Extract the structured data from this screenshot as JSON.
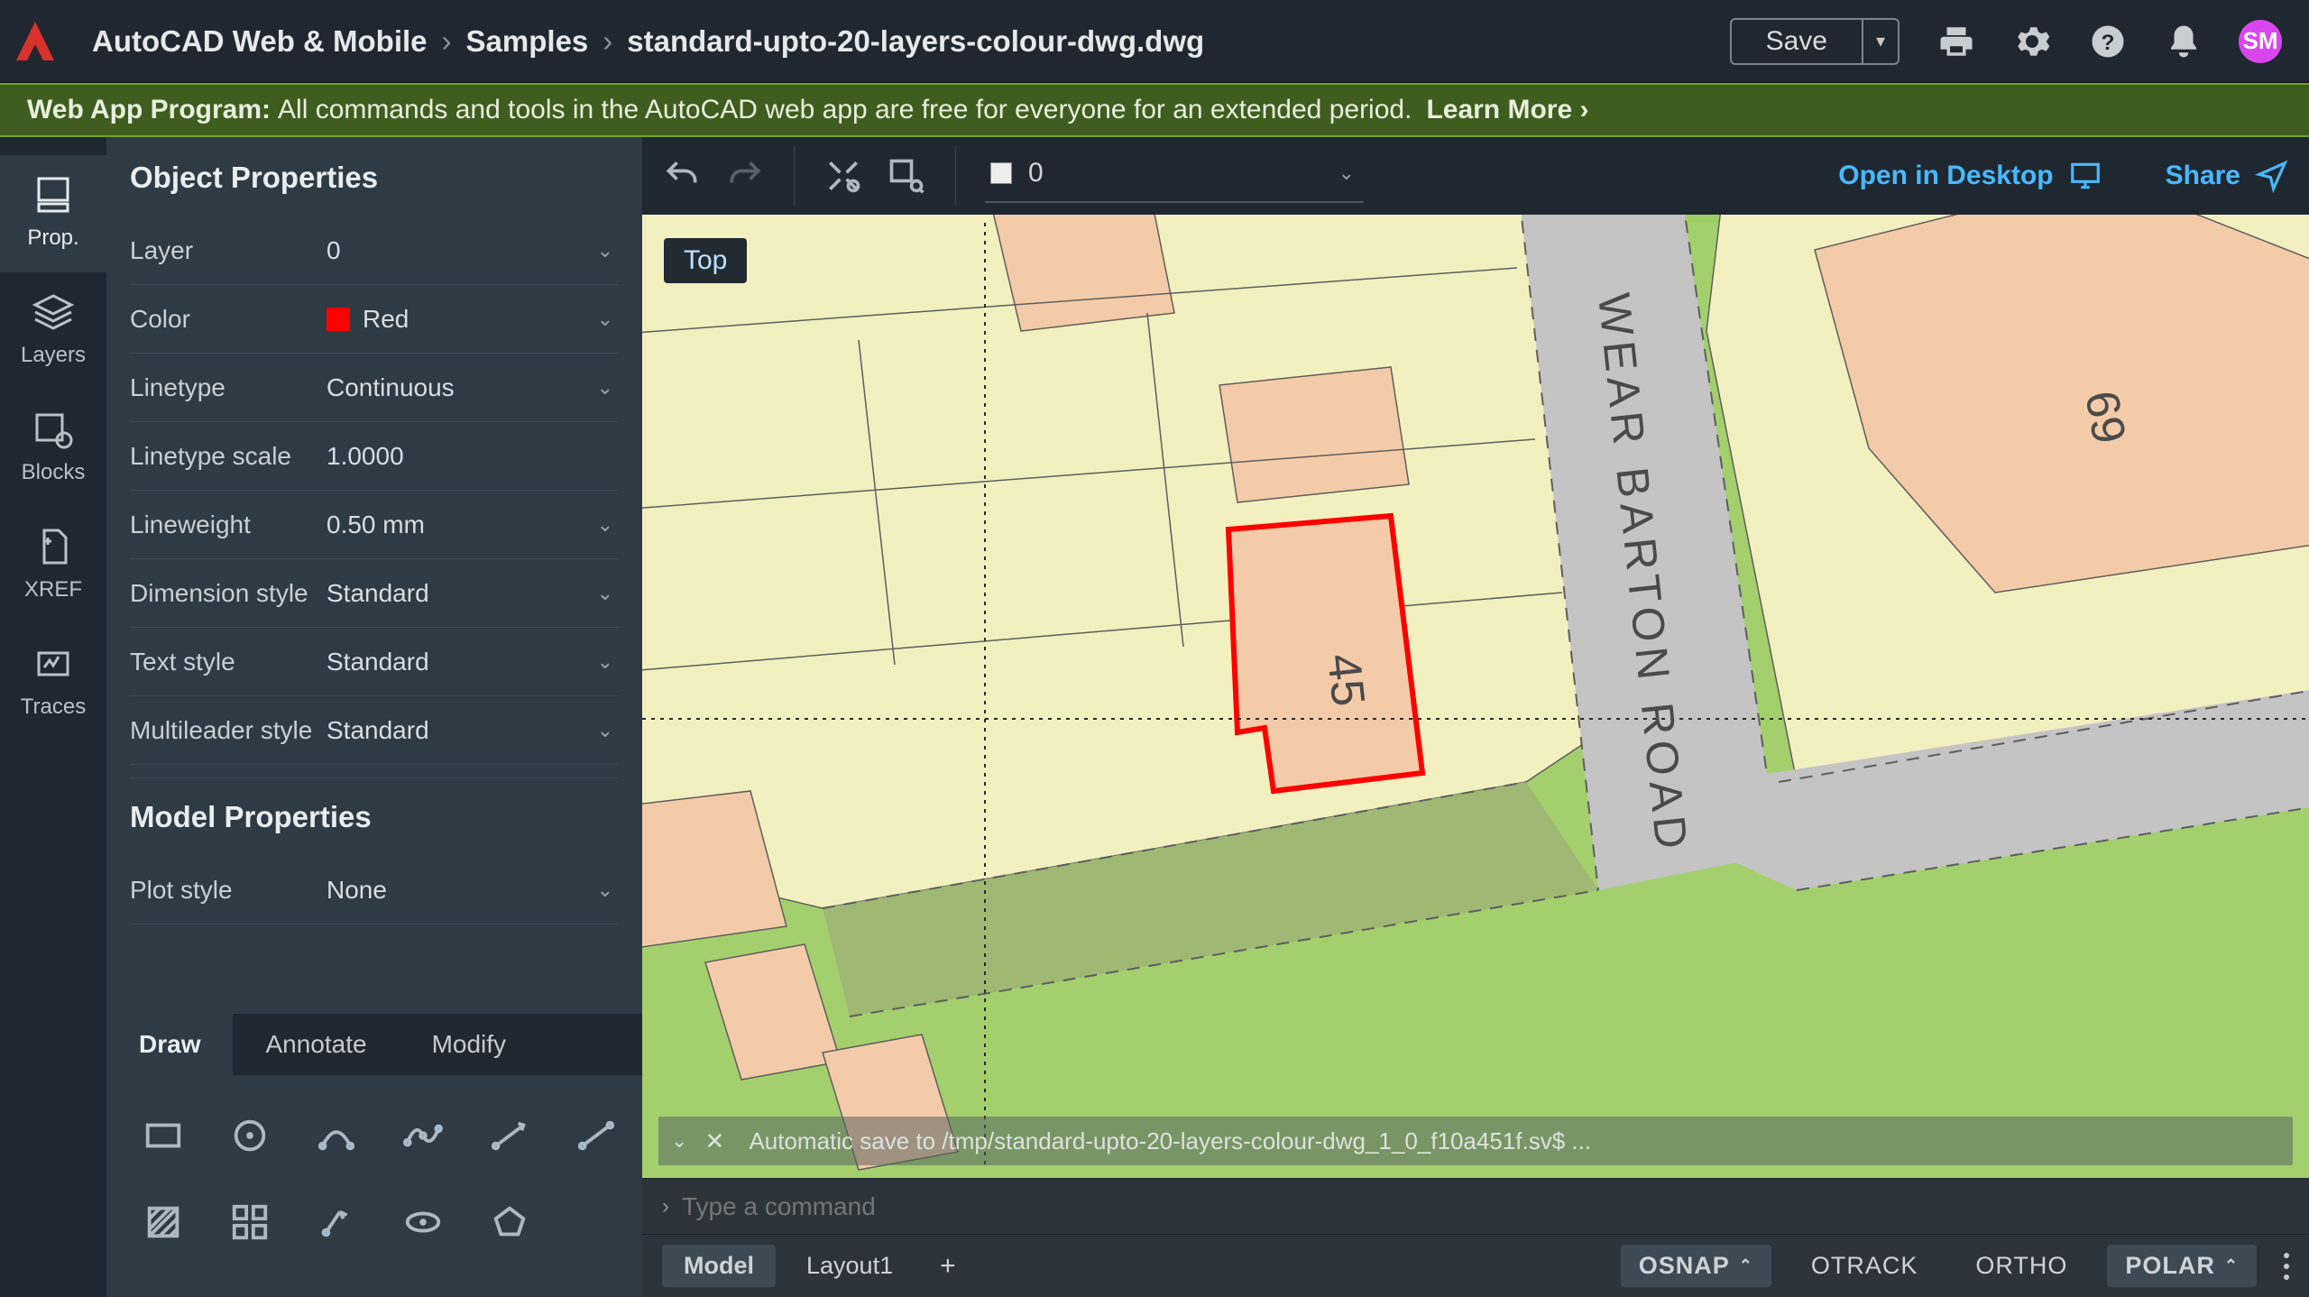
{
  "breadcrumb": {
    "root": "AutoCAD Web & Mobile",
    "mid": "Samples",
    "file": "standard-upto-20-layers-colour-dwg.dwg"
  },
  "topbar": {
    "save": "Save",
    "avatar": "SM"
  },
  "banner": {
    "title": "Web App Program:",
    "text": "All commands and tools in the AutoCAD web app are free for everyone for an extended period.",
    "learn": "Learn More ›"
  },
  "nav": {
    "props": "Prop.",
    "layers": "Layers",
    "blocks": "Blocks",
    "xref": "XREF",
    "traces": "Traces"
  },
  "props": {
    "heading": "Object Properties",
    "layer": {
      "label": "Layer",
      "value": "0"
    },
    "color": {
      "label": "Color",
      "value": "Red",
      "hex": "#ff0000"
    },
    "linetype": {
      "label": "Linetype",
      "value": "Continuous"
    },
    "ltscale": {
      "label": "Linetype scale",
      "value": "1.0000"
    },
    "lweight": {
      "label": "Lineweight",
      "value": "0.50 mm"
    },
    "dimstyle": {
      "label": "Dimension style",
      "value": "Standard"
    },
    "textstyle": {
      "label": "Text style",
      "value": "Standard"
    },
    "mleader": {
      "label": "Multileader style",
      "value": "Standard"
    },
    "model_heading": "Model Properties",
    "plotstyle": {
      "label": "Plot style",
      "value": "None"
    }
  },
  "tooltabs": {
    "draw": "Draw",
    "annotate": "Annotate",
    "modify": "Modify"
  },
  "canvas_tools": {
    "layer_value": "0",
    "open": "Open in Desktop",
    "share": "Share"
  },
  "canvas": {
    "view": "Top",
    "street": "WEAR BARTON ROAD",
    "house45": "45",
    "house69": "69",
    "save_msg": "Automatic save to /tmp/standard-upto-20-layers-colour-dwg_1_0_f10a451f.sv$ ..."
  },
  "cmd": {
    "placeholder": "Type a command"
  },
  "bottabs": {
    "model": "Model",
    "layout1": "Layout1",
    "osnap": "OSNAP",
    "otrack": "OTRACK",
    "ortho": "ORTHO",
    "polar": "POLAR"
  }
}
